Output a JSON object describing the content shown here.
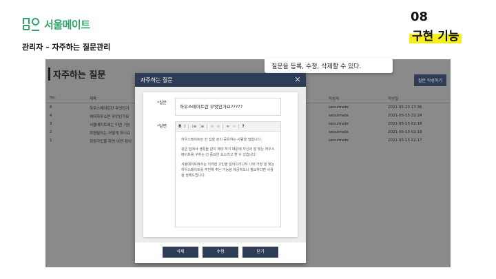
{
  "slide": {
    "logo_text": "서울메이트",
    "subtitle": "관리자 – 자주하는 질문관리",
    "section_number": "08",
    "section_title": "구현 기능"
  },
  "callout": "질문을 등록, 수정, 삭제할 수 있다.",
  "page": {
    "title": "자주하는 질문",
    "register_button": "질문 작성하기",
    "table": {
      "headers": {
        "no": "No.",
        "title": "제목",
        "author": "작성자",
        "date": "작성일"
      },
      "rows": [
        {
          "no": "8",
          "title": "하우스메이트란 무엇인가",
          "author": "seoulmate",
          "date": "2021-05-23 17:36"
        },
        {
          "no": "4",
          "title": "쉐어하우스란 무엇인가요",
          "author": "seoulmate",
          "date": "2021-05-15 22:24"
        },
        {
          "no": "3",
          "title": "서울메이트에는 어떤 기능",
          "author": "seoulmate",
          "date": "2021-05-15 02:18"
        },
        {
          "no": "2",
          "title": "회원탈퇴는 어떻게 하나요",
          "author": "seoulmate",
          "date": "2021-05-15 02:18"
        },
        {
          "no": "1",
          "title": "회원가입을 하면 어떤 점이",
          "author": "seoulmate",
          "date": "2021-05-15 02:17"
        }
      ]
    }
  },
  "modal": {
    "title": "자주하는 질문",
    "question_label": "질문",
    "question_value": "하우스메이트란 무엇인가요?????",
    "answer_label": "답변",
    "toolbar": [
      "B",
      "I",
      "?"
    ],
    "answer_paragraphs": [
      "하우스메이트란 한 집을 같이 공유하는 사람을 말합니다.",
      "같은 집에서 생활을 같이 해야 하기 때문에 자신과 잘 맞는 하우스메이트를 구하는 건 중요한 요소라고 할 수 있습니다.",
      "서울메이트에서는 이러한 고민을 덜어드리고자 나와 가장 잘 맞는 하우스메이트를 추천해 주는 기능을 제공하오니 필요하다면 사용을 권해드립니다."
    ],
    "buttons": {
      "delete": "삭제",
      "edit": "수정",
      "close": "닫기"
    }
  },
  "colors": {
    "brand": "#2fa56a",
    "navy": "#2e3d55",
    "highlight": "#f5ee1d"
  }
}
